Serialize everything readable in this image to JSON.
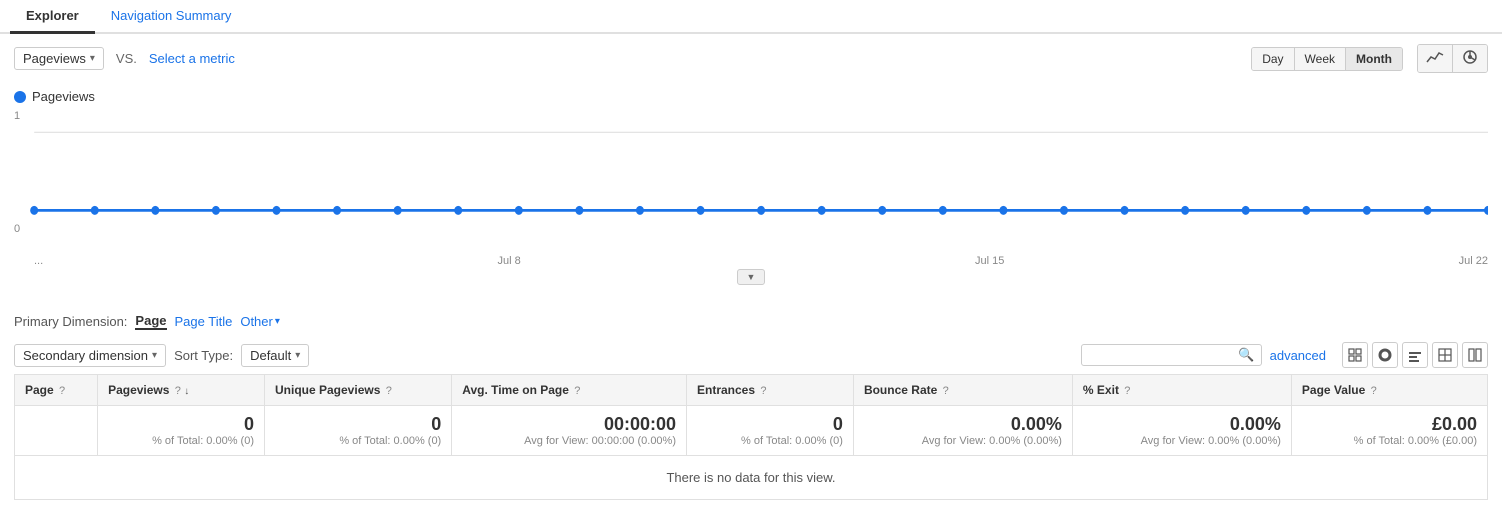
{
  "tabs": [
    {
      "label": "Explorer",
      "active": true,
      "link": false
    },
    {
      "label": "Navigation Summary",
      "active": false,
      "link": true
    }
  ],
  "toolbar": {
    "metric": "Pageviews",
    "vs_label": "VS.",
    "select_metric": "Select a metric",
    "time_buttons": [
      "Day",
      "Week",
      "Month"
    ],
    "active_time": "Month"
  },
  "chart": {
    "legend_label": "Pageviews",
    "y_top": "1",
    "y_bottom": "0",
    "x_labels": [
      "...",
      "Jul 8",
      "Jul 15",
      "Jul 22"
    ]
  },
  "primary_dimension": {
    "label": "Primary Dimension:",
    "options": [
      "Page",
      "Page Title",
      "Other"
    ]
  },
  "secondary_toolbar": {
    "secondary_dimension": "Secondary dimension",
    "sort_label": "Sort Type:",
    "sort_default": "Default",
    "search_placeholder": "",
    "advanced_label": "advanced"
  },
  "table": {
    "columns": [
      {
        "name": "Page",
        "help": "?",
        "sort": false
      },
      {
        "name": "Pageviews",
        "help": "?",
        "sort": true
      },
      {
        "name": "Unique Pageviews",
        "help": "?",
        "sort": false
      },
      {
        "name": "Avg. Time on Page",
        "help": "?",
        "sort": false
      },
      {
        "name": "Entrances",
        "help": "?",
        "sort": false
      },
      {
        "name": "Bounce Rate",
        "help": "?",
        "sort": false
      },
      {
        "name": "% Exit",
        "help": "?",
        "sort": false
      },
      {
        "name": "Page Value",
        "help": "?",
        "sort": false
      }
    ],
    "totals": [
      {
        "main": "0",
        "sub": "% of Total: 0.00% (0)"
      },
      {
        "main": "0",
        "sub": "% of Total: 0.00% (0)"
      },
      {
        "main": "00:00:00",
        "sub": "Avg for View: 00:00:00 (0.00%)"
      },
      {
        "main": "0",
        "sub": "% of Total: 0.00% (0)"
      },
      {
        "main": "0.00%",
        "sub": "Avg for View: 0.00% (0.00%)"
      },
      {
        "main": "0.00%",
        "sub": "Avg for View: 0.00% (0.00%)"
      },
      {
        "main": "£0.00",
        "sub": "% of Total: 0.00% (£0.00)"
      }
    ],
    "no_data_message": "There is no data for this view."
  },
  "icons": {
    "line_chart": "📈",
    "pie_chart": "👤",
    "grid": "▦",
    "bar": "▤",
    "list": "≡",
    "pivot": "⊞",
    "compare": "⊟"
  }
}
